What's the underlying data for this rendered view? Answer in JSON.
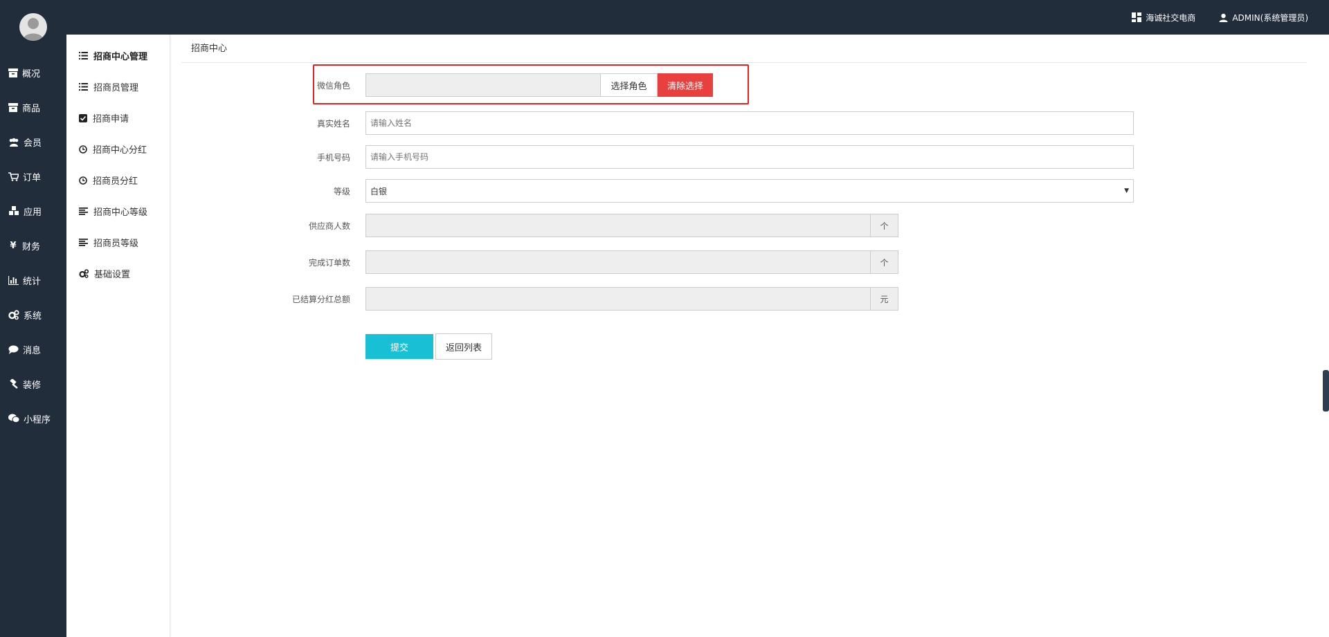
{
  "header": {
    "shop_name": "海诚社交电商",
    "user": "ADMIN(系统管理员)"
  },
  "main_nav": [
    {
      "label": "概况",
      "icon": "archive-icon"
    },
    {
      "label": "商品",
      "icon": "archive-icon"
    },
    {
      "label": "会员",
      "icon": "users-icon"
    },
    {
      "label": "订单",
      "icon": "cart-icon"
    },
    {
      "label": "应用",
      "icon": "cubes-icon"
    },
    {
      "label": "财务",
      "icon": "yen-icon"
    },
    {
      "label": "统计",
      "icon": "bar-chart-icon"
    },
    {
      "label": "系统",
      "icon": "gears-icon"
    },
    {
      "label": "消息",
      "icon": "comment-icon"
    },
    {
      "label": "装修",
      "icon": "gavel-icon"
    },
    {
      "label": "小程序",
      "icon": "wechat-icon"
    }
  ],
  "sub_nav": [
    {
      "label": "招商中心管理",
      "icon": "list-icon",
      "active": true
    },
    {
      "label": "招商员管理",
      "icon": "list-icon"
    },
    {
      "label": "招商申请",
      "icon": "check-square-icon"
    },
    {
      "label": "招商中心分红",
      "icon": "clock-icon"
    },
    {
      "label": "招商员分红",
      "icon": "clock-icon"
    },
    {
      "label": "招商中心等级",
      "icon": "align-left-icon"
    },
    {
      "label": "招商员等级",
      "icon": "align-left-icon"
    },
    {
      "label": "基础设置",
      "icon": "gears-icon"
    }
  ],
  "breadcrumb": "招商中心",
  "form": {
    "wechat_role": {
      "label": "微信角色",
      "value": "",
      "select_btn": "选择角色",
      "clear_btn": "清除选择"
    },
    "real_name": {
      "label": "真实姓名",
      "placeholder": "请输入姓名"
    },
    "phone": {
      "label": "手机号码",
      "placeholder": "请输入手机号码"
    },
    "level": {
      "label": "等级",
      "value": "白银"
    },
    "supplier_count": {
      "label": "供应商人数",
      "value": "",
      "unit": "个"
    },
    "orders_done": {
      "label": "完成订单数",
      "value": "",
      "unit": "个"
    },
    "dividend_total": {
      "label": "已结算分红总额",
      "value": "",
      "unit": "元"
    },
    "submit_btn": "提交",
    "back_btn": "返回列表"
  },
  "colors": {
    "sidebar_bg": "#222d3c",
    "primary": "#18c0d6",
    "danger": "#e8403e",
    "highlight": "#e82020"
  }
}
